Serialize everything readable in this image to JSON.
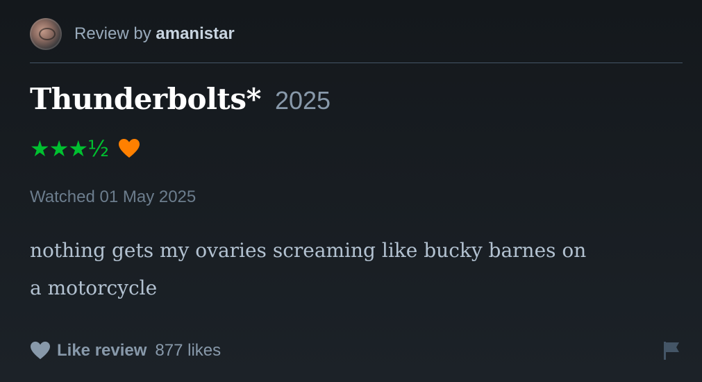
{
  "header": {
    "prefix": "Review by ",
    "username": "amanistar",
    "avatar_icon": "user-avatar"
  },
  "film": {
    "title": "Thunderbolts*",
    "year": "2025"
  },
  "rating": {
    "stars_text": "★★★½",
    "value": 3.5,
    "max": 5,
    "liked": true,
    "star_color": "#00c030",
    "heart_color": "#ff8000"
  },
  "watched": {
    "text": "Watched 01 May 2025"
  },
  "review": {
    "line1": "nothing gets my ovaries screaming like bucky barnes on",
    "line2": "a motorcycle"
  },
  "footer": {
    "like_label": "Like review",
    "likes_count": "877 likes",
    "like_icon": "heart-icon",
    "report_icon": "flag-icon"
  },
  "colors": {
    "background": "#14181c",
    "accent_green": "#00c030",
    "accent_orange": "#ff8000",
    "muted_text": "#99aabb"
  }
}
